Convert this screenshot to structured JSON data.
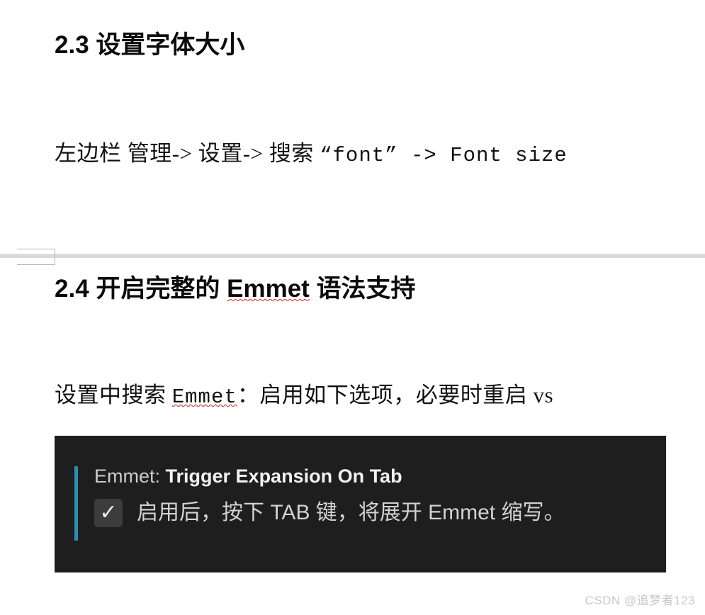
{
  "document": {
    "background_color": "#ffffff",
    "text_color": "#000000"
  },
  "sections": [
    {
      "id": "2.3",
      "heading": "2.3 设置字体大小",
      "paragraph": "左边栏 管理-> 设置-> 搜索 “font” -> Font size",
      "paragraph_parts": {
        "lead": "左边栏 管理-> 设置-> 搜索 ",
        "quoted_query": "“font”",
        "arrow": " -> ",
        "target": "Font size"
      }
    },
    {
      "id": "2.4",
      "heading": "2.4 开启完整的 Emmet 语法支持",
      "heading_parts": {
        "prefix": "2.4 开启完整的 ",
        "misspelled_term": "Emmet",
        "suffix": " 语法支持"
      },
      "paragraph": "设置中搜索 Emmet：启用如下选项，必要时重启 vs",
      "paragraph_parts": {
        "lead": "设置中搜索 ",
        "misspelled_term": "Emmet",
        "tail": "：启用如下选项，必要时重启 vs"
      }
    }
  ],
  "divider": {
    "line_color": "#dadada",
    "marker_border_color": "#b6b6b6"
  },
  "vscode_setting": {
    "panel_background": "#1e1e1e",
    "accent_color": "#2392b8",
    "title_prefix": "Emmet:",
    "title_key": " Trigger Expansion On Tab",
    "title_full": "Emmet: Trigger Expansion On Tab",
    "checkbox": {
      "state": "checked",
      "glyph": "✓",
      "background_color": "#3c3c3c"
    },
    "description": "启用后，按下 TAB 键，将展开 Emmet 缩写。"
  },
  "watermark": {
    "text": "CSDN @追梦者123",
    "color": "#c9c9c9"
  }
}
